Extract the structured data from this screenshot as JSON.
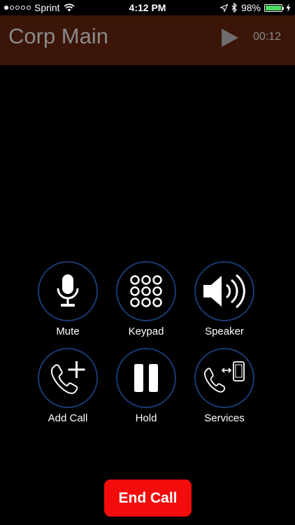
{
  "status_bar": {
    "carrier": "Sprint",
    "signal_strength": "1 of 5 dots",
    "time": "4:12 PM",
    "battery_percent": "98%",
    "battery_level": 0.98,
    "icons": [
      "wifi-icon",
      "location-arrow-icon",
      "bluetooth-icon",
      "battery-icon",
      "charging-bolt-icon"
    ]
  },
  "call_header": {
    "title": "Corp Main",
    "timer": "00:12",
    "background_color": "#3a1508",
    "play_icon": "play-icon"
  },
  "controls": [
    {
      "label": "Mute",
      "icon": "microphone-icon"
    },
    {
      "label": "Keypad",
      "icon": "keypad-icon"
    },
    {
      "label": "Speaker",
      "icon": "speaker-icon"
    },
    {
      "label": "Add Call",
      "icon": "add-call-icon"
    },
    {
      "label": "Hold",
      "icon": "pause-icon"
    },
    {
      "label": "Services",
      "icon": "transfer-to-phone-icon"
    }
  ],
  "end_call": {
    "label": "End Call",
    "color": "#f20c0c"
  },
  "colors": {
    "ring_border": "#1a3a72",
    "header_text": "#8a8a8a"
  }
}
